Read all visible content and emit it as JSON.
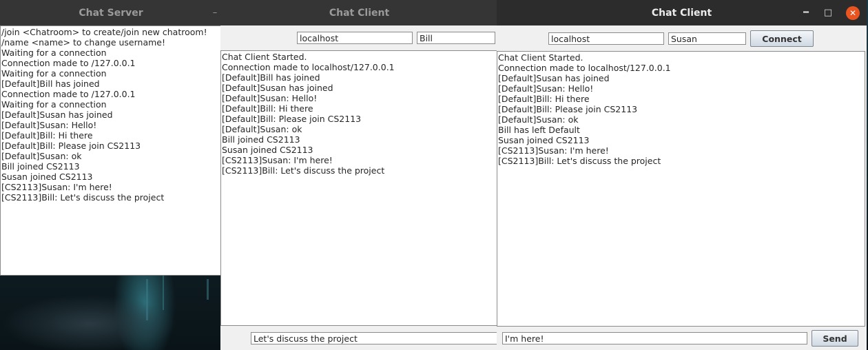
{
  "server_window": {
    "title": "Chat Server",
    "log": [
      "/join <Chatroom> to create/join new chatroom!",
      "/name <name> to change username!",
      "Waiting for a connection",
      "Connection made to /127.0.0.1",
      "Waiting for a connection",
      "[Default]Bill has joined",
      "Connection made to /127.0.0.1",
      "Waiting for a connection",
      "[Default]Susan has joined",
      "[Default]Susan: Hello!",
      "[Default]Bill: Hi there",
      "[Default]Bill: Please join CS2113",
      "[Default]Susan: ok",
      "Bill joined CS2113",
      "Susan joined CS2113",
      "[CS2113]Susan: I'm here!",
      "[CS2113]Bill: Let's discuss the project"
    ]
  },
  "client_bill": {
    "title": "Chat Client",
    "host": "localhost",
    "username": "Bill",
    "log": [
      "Chat Client Started.",
      "Connection made to localhost/127.0.0.1",
      "[Default]Bill has joined",
      "[Default]Susan has joined",
      "[Default]Susan: Hello!",
      "[Default]Bill: Hi there",
      "[Default]Bill: Please join CS2113",
      "[Default]Susan: ok",
      "Bill joined CS2113",
      "Susan joined CS2113",
      "[CS2113]Susan: I'm here!",
      "[CS2113]Bill: Let's discuss the project"
    ],
    "message": "Let's discuss the project"
  },
  "client_susan": {
    "title": "Chat Client",
    "host": "localhost",
    "username": "Susan",
    "connect_label": "Connect",
    "log": [
      "Chat Client Started.",
      "Connection made to localhost/127.0.0.1",
      "[Default]Susan has joined",
      "[Default]Susan: Hello!",
      "[Default]Bill: Hi there",
      "[Default]Bill: Please join CS2113",
      "[Default]Susan: ok",
      "Bill has left Default",
      "Susan joined CS2113",
      "[CS2113]Susan: I'm here!",
      "[CS2113]Bill: Let's discuss the project"
    ],
    "message": "I'm here!",
    "send_label": "Send",
    "window_controls": {
      "minimize": "minimize-icon",
      "maximize": "maximize-icon",
      "close": "close-icon"
    }
  }
}
